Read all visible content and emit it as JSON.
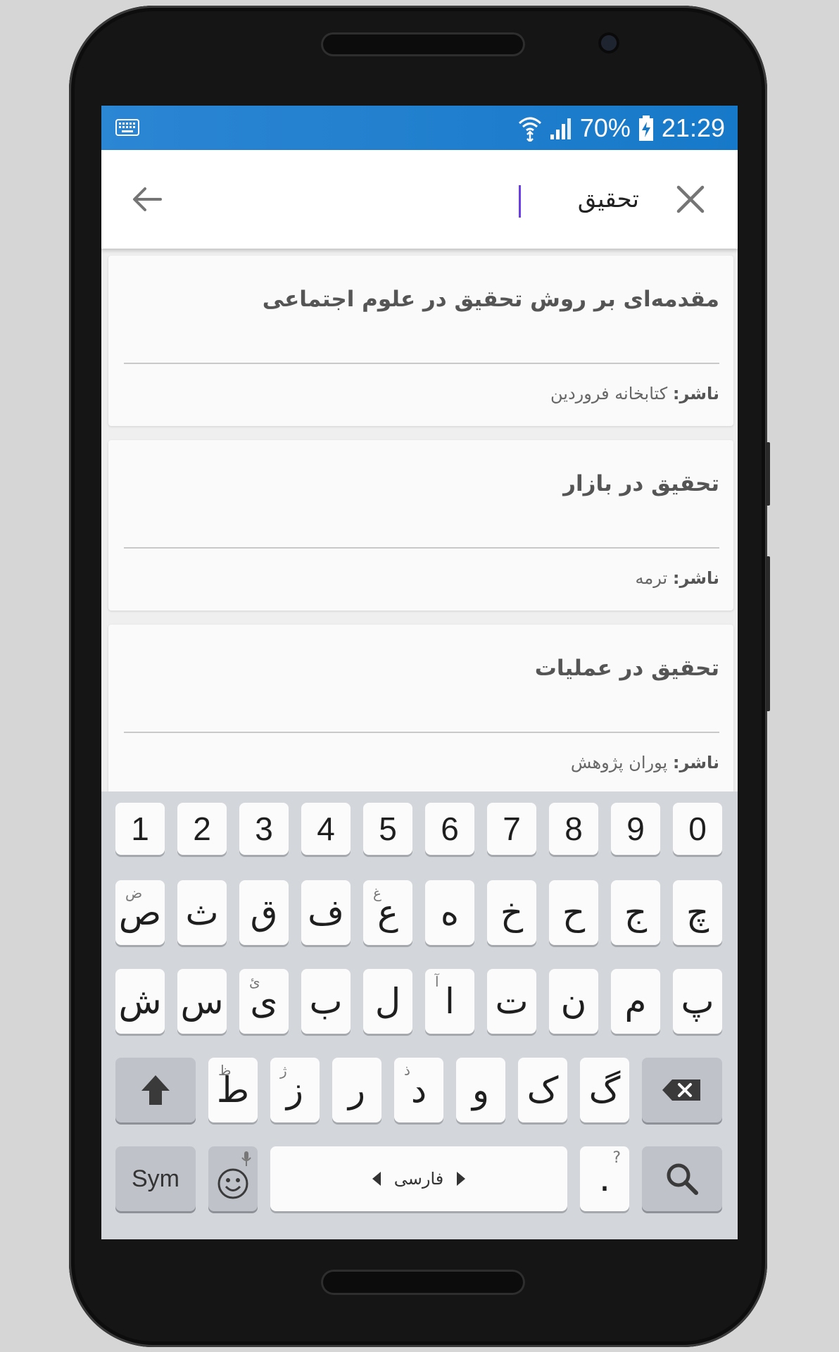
{
  "status_bar": {
    "battery": "70%",
    "time": "21:29"
  },
  "search": {
    "query": "تحقیق"
  },
  "results": [
    {
      "title": "مقدمه‌ای بر روش تحقیق در علوم اجتماعی",
      "publisher_label": "ناشر:",
      "publisher": "کتابخانه فروردین"
    },
    {
      "title": "تحقیق در بازار",
      "publisher_label": "ناشر:",
      "publisher": "ترمه"
    },
    {
      "title": "تحقیق در عملیات",
      "publisher_label": "ناشر:",
      "publisher": "پوران پژوهش"
    }
  ],
  "keyboard": {
    "numbers": [
      "1",
      "2",
      "3",
      "4",
      "5",
      "6",
      "7",
      "8",
      "9",
      "0"
    ],
    "row1": [
      {
        "main": "ص",
        "alt": "ض"
      },
      {
        "main": "ث",
        "alt": ""
      },
      {
        "main": "ق",
        "alt": ""
      },
      {
        "main": "ف",
        "alt": ""
      },
      {
        "main": "ع",
        "alt": "غ"
      },
      {
        "main": "ه",
        "alt": ""
      },
      {
        "main": "خ",
        "alt": ""
      },
      {
        "main": "ح",
        "alt": ""
      },
      {
        "main": "ج",
        "alt": ""
      },
      {
        "main": "چ",
        "alt": ""
      }
    ],
    "row2": [
      {
        "main": "ش",
        "alt": ""
      },
      {
        "main": "س",
        "alt": ""
      },
      {
        "main": "ی",
        "alt": "ئ"
      },
      {
        "main": "ب",
        "alt": ""
      },
      {
        "main": "ل",
        "alt": ""
      },
      {
        "main": "ا",
        "alt": "آ"
      },
      {
        "main": "ت",
        "alt": ""
      },
      {
        "main": "ن",
        "alt": ""
      },
      {
        "main": "م",
        "alt": ""
      },
      {
        "main": "پ",
        "alt": ""
      }
    ],
    "row3": [
      {
        "main": "ط",
        "alt": "ظ"
      },
      {
        "main": "ز",
        "alt": "ژ"
      },
      {
        "main": "ر",
        "alt": ""
      },
      {
        "main": "د",
        "alt": "ذ"
      },
      {
        "main": "و",
        "alt": ""
      },
      {
        "main": "ک",
        "alt": ""
      },
      {
        "main": "گ",
        "alt": ""
      }
    ],
    "sym_label": "Sym",
    "space_label": "فارسی",
    "period_key": ".",
    "period_alt": "?",
    "colors": {
      "background": "#d3d6db",
      "key": "#fbfbfb",
      "dark_key": "#bfc2c8"
    }
  },
  "colors": {
    "status_bar": "#1779c9",
    "caret": "#6a3de8"
  }
}
